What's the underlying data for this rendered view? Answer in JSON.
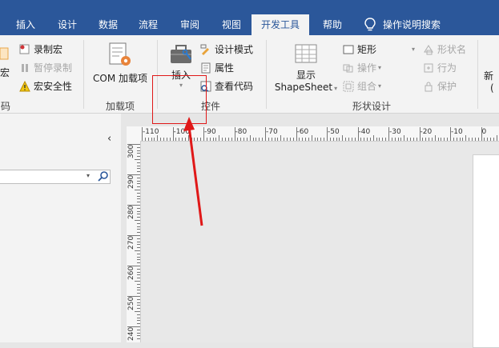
{
  "tabs": [
    {
      "label": "插入"
    },
    {
      "label": "设计"
    },
    {
      "label": "数据"
    },
    {
      "label": "流程"
    },
    {
      "label": "审阅"
    },
    {
      "label": "视图"
    },
    {
      "label": "开发工具",
      "active": true
    },
    {
      "label": "帮助"
    }
  ],
  "tell_me": {
    "label": "操作说明搜索",
    "icon": "lightbulb-icon"
  },
  "ribbon": {
    "code_group": {
      "macro_partial": "宏",
      "record_macro": "录制宏",
      "pause_recording": "暂停录制",
      "macro_security": "宏安全性",
      "label_partial": "码"
    },
    "addins_group": {
      "com_addins": "COM 加载项",
      "label": "加载项"
    },
    "controls_group": {
      "insert": "插入",
      "design_mode": "设计模式",
      "properties": "属性",
      "view_code": "查看代码",
      "label": "控件"
    },
    "shape_design_group": {
      "show_shapesheet_line1": "显示",
      "show_shapesheet_line2": "ShapeSheet",
      "rectangle": "矩形",
      "operations": "操作",
      "group": "组合",
      "shape_name": "形状名",
      "behavior": "行为",
      "protect": "保护",
      "label": "形状设计"
    },
    "new_partial_line1": "新",
    "new_partial_line2": "("
  },
  "ruler": {
    "top_labels": [
      "-110",
      "-100",
      "-90",
      "-80",
      "-70",
      "-60",
      "-50",
      "-40",
      "-30",
      "-20",
      "-10",
      "0"
    ],
    "left_labels": [
      "300",
      "290",
      "280",
      "270",
      "260",
      "250",
      "240"
    ]
  },
  "colors": {
    "accent": "#2b579a",
    "annotation": "#e01818"
  }
}
